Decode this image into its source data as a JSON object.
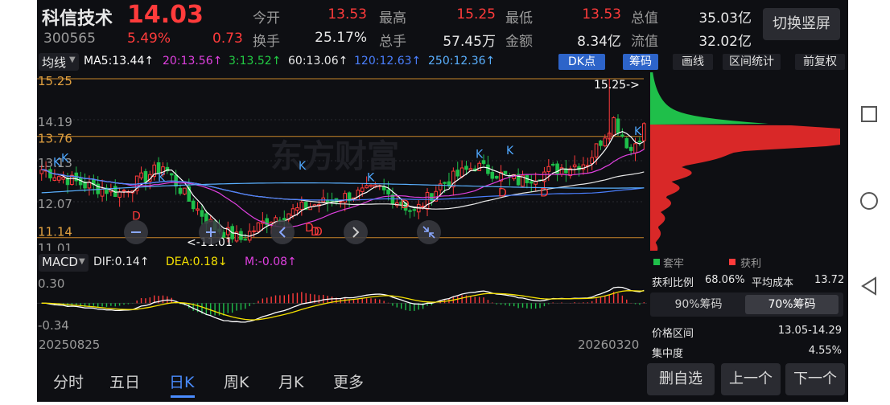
{
  "header": {
    "name": "科信技术",
    "price": "14.03",
    "code": "300565",
    "change_pct": "5.49%",
    "change": "0.73",
    "switch_label": "切换竖屏",
    "stats": [
      {
        "label": "今开",
        "value": "13.53",
        "color": "red"
      },
      {
        "label": "最高",
        "value": "15.25",
        "color": "red"
      },
      {
        "label": "最低",
        "value": "13.53",
        "color": "red"
      },
      {
        "label": "总值",
        "value": "35.03亿",
        "color": "white"
      },
      {
        "label": "换手",
        "value": "25.17%",
        "color": "white"
      },
      {
        "label": "总手",
        "value": "57.45万",
        "color": "white"
      },
      {
        "label": "金额",
        "value": "8.34亿",
        "color": "white"
      },
      {
        "label": "流值",
        "value": "32.02亿",
        "color": "white"
      }
    ]
  },
  "toolbar": {
    "ma_select": "均线",
    "ma_items": [
      {
        "text": "MA5:13.44↑",
        "color": "#ffffff"
      },
      {
        "text": "20:13.56↑",
        "color": "#e040e0"
      },
      {
        "text": "3:13.52↑",
        "color": "#22cc44"
      },
      {
        "text": "60:13.06↑",
        "color": "#e8e8e8"
      },
      {
        "text": "120:12.63↑",
        "color": "#4a7fff"
      },
      {
        "text": "250:12.36↑",
        "color": "#5ab0ff"
      }
    ],
    "buttons": [
      {
        "label": "DK点",
        "style": "blue"
      },
      {
        "label": "筹码",
        "style": "blue"
      },
      {
        "label": "画线",
        "style": "dark"
      },
      {
        "label": "区间统计",
        "style": "dark"
      },
      {
        "label": "前复权",
        "style": "dark"
      }
    ]
  },
  "kline": {
    "price_labels": [
      "15.25",
      "14.19",
      "13.76",
      "13.13",
      "12.07",
      "11.14",
      "11.01"
    ],
    "high_marker": "15.25->",
    "low_marker": "<-11.01",
    "k_marks": [
      "K",
      "K",
      "K",
      "K",
      "K",
      "K",
      "K",
      "K"
    ],
    "d_marks": [
      "D",
      "D",
      "D",
      "D",
      "D",
      "D",
      "D"
    ],
    "watermark": "东方财富",
    "controls": [
      "minus-icon",
      "plus-icon",
      "prev-icon",
      "next-icon",
      "shrink-icon"
    ]
  },
  "macd": {
    "label": "MACD",
    "dif": "DIF:0.14↑",
    "dea": "DEA:0.18↓",
    "m": "M:-0.08↑",
    "axis_top": "0.30",
    "axis_bottom": "-0.34",
    "date_start": "20250825",
    "date_end": "20260320",
    "colors": {
      "dif": "#ffffff",
      "dea": "#f5e100",
      "m": "#e040e0"
    }
  },
  "chips": {
    "legend_trap": "套牢",
    "legend_profit": "获利",
    "profit_ratio_label": "获利比例",
    "profit_ratio": "68.06%",
    "avg_cost_label": "平均成本",
    "avg_cost": "13.72",
    "tabs": [
      "90%筹码",
      "70%筹码"
    ],
    "active_tab": 1,
    "range_label": "价格区间",
    "range_value": "13.05-14.29",
    "concentration_label": "集中度",
    "concentration_value": "4.55%"
  },
  "bottom_tabs": [
    "分时",
    "五日",
    "日K",
    "周K",
    "月K",
    "更多"
  ],
  "active_bottom_tab": 2,
  "bottom_buttons": [
    "删自选",
    "上一个",
    "下一个"
  ],
  "colors": {
    "up": "#ff3b3b",
    "down": "#1fbf4a",
    "accent": "#2d64c9",
    "bg": "#0e0f13"
  }
}
